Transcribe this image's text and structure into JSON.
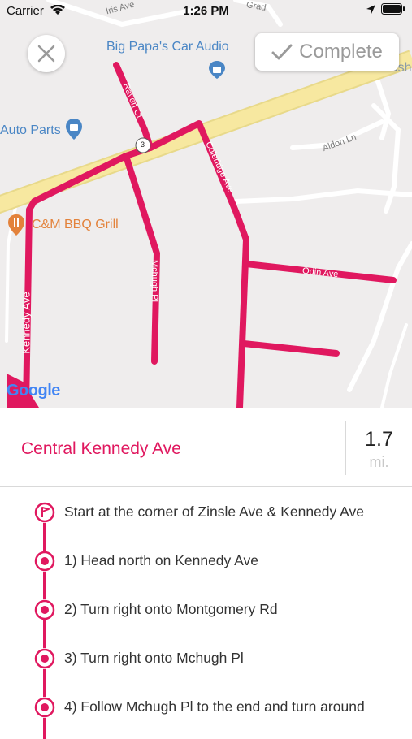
{
  "status_bar": {
    "carrier": "Carrier",
    "time": "1:26 PM"
  },
  "map": {
    "places": {
      "car_audio": "Big Papa's Car Audio",
      "auto_parts": "Auto Parts",
      "bbq": "C&M BBQ Grill",
      "car_wash": "Car Wash"
    },
    "roads": {
      "iris": "Iris Ave",
      "grad": "Grad",
      "aldon": "Aldon Ln",
      "raven": "Raven Ct",
      "coleridge": "Coleridge Ave",
      "odin": "Odin Ave",
      "mchugh": "Mchugh Pl",
      "kennedy": "Kennedy Ave",
      "route_shield": "3"
    },
    "attribution": "Google"
  },
  "toolbar": {
    "complete_label": "Complete"
  },
  "route": {
    "name": "Central Kennedy Ave",
    "distance": "1.7",
    "unit": "mi."
  },
  "directions": [
    "Start at the corner of Zinsle Ave & Kennedy Ave",
    "1) Head north on Kennedy Ave",
    "2) Turn right onto Montgomery Rd",
    "3) Turn right onto Mchugh Pl",
    "4) Follow Mchugh Pl to the end and turn around"
  ],
  "colors": {
    "accent": "#e0185f",
    "map_bg": "#efeded",
    "highway": "#f7e8a0",
    "place_blue": "#4a86c5",
    "place_orange": "#e3823b"
  },
  "icons": [
    "close-icon",
    "checkmark-icon",
    "wifi-icon",
    "location-arrow-icon",
    "battery-icon",
    "shopping-bag-icon",
    "restaurant-icon",
    "start-flag-icon",
    "step-dot-icon"
  ]
}
